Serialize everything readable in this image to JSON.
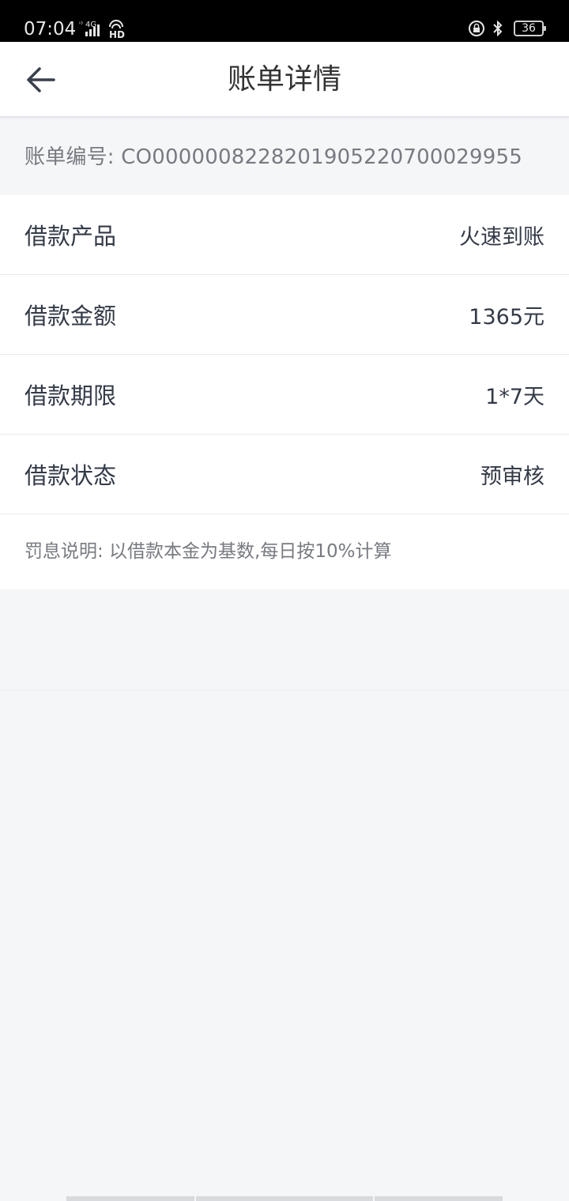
{
  "status_bar": {
    "time": "07:04",
    "network": "4G",
    "hd": "HD",
    "battery": "36"
  },
  "header": {
    "title": "账单详情"
  },
  "bill": {
    "number_label": "账单编号: CO0000008228201905220700029955"
  },
  "details": [
    {
      "label": "借款产品",
      "value": "火速到账"
    },
    {
      "label": "借款金额",
      "value": "1365元"
    },
    {
      "label": "借款期限",
      "value": "1*7天"
    },
    {
      "label": "借款状态",
      "value": "预审核"
    }
  ],
  "penalty_note": "罚息说明: 以借款本金为基数,每日按10%计算",
  "icons": {
    "back": "arrow-left-icon",
    "signal": "signal-bars-icon",
    "lock": "rotation-lock-icon",
    "bluetooth": "bluetooth-icon",
    "battery": "battery-icon"
  },
  "colors": {
    "status_bar_bg": "#000000",
    "page_bg": "#f5f6f8",
    "card_bg": "#ffffff",
    "primary_text": "#333a47",
    "secondary_text": "#777a80"
  }
}
